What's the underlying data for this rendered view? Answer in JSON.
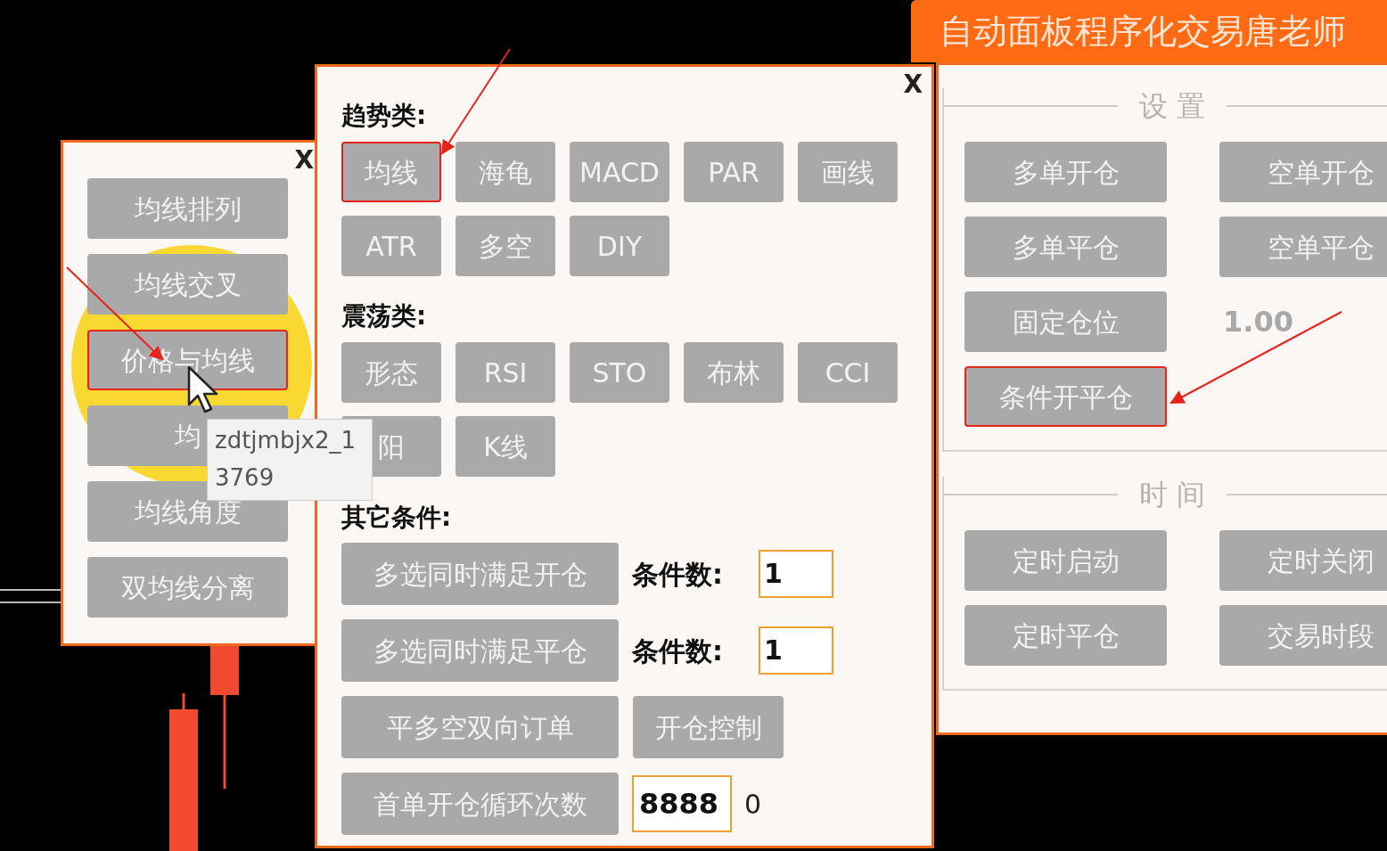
{
  "left_panel": {
    "close": "X",
    "buttons": [
      {
        "label": "均线排列",
        "annotated": false
      },
      {
        "label": "均线交叉",
        "annotated": false
      },
      {
        "label": "价格与均线",
        "annotated": true
      },
      {
        "label": "均",
        "annotated": false
      },
      {
        "label": "均线角度",
        "annotated": false
      },
      {
        "label": "双均线分离",
        "annotated": false
      }
    ]
  },
  "tooltip": {
    "lines": [
      "zdtjmbjx2_1",
      "3769"
    ]
  },
  "middle_panel": {
    "close": "X",
    "sections": [
      {
        "title": "趋势类:",
        "rows": [
          [
            {
              "label": "均线",
              "annotated": true
            },
            {
              "label": "海龟",
              "annotated": false
            },
            {
              "label": "MACD",
              "annotated": false
            },
            {
              "label": "PAR",
              "annotated": false
            },
            {
              "label": "画线",
              "annotated": false
            }
          ],
          [
            {
              "label": "ATR",
              "annotated": false
            },
            {
              "label": "多空",
              "annotated": false
            },
            {
              "label": "DIY",
              "annotated": false
            }
          ]
        ]
      },
      {
        "title": "震荡类:",
        "rows": [
          [
            {
              "label": "形态",
              "annotated": false
            },
            {
              "label": "RSI",
              "annotated": false
            },
            {
              "label": "STO",
              "annotated": false
            },
            {
              "label": "布林",
              "annotated": false
            },
            {
              "label": "CCI",
              "annotated": false
            }
          ],
          [
            {
              "label": "阳",
              "annotated": false
            },
            {
              "label": "K线",
              "annotated": false
            }
          ]
        ]
      }
    ],
    "other": {
      "title": "其它条件:",
      "rows": [
        {
          "kind": "count",
          "button": "多选同时满足开仓",
          "label": "条件数:",
          "value": "1"
        },
        {
          "kind": "count",
          "button": "多选同时满足平仓",
          "label": "条件数:",
          "value": "1"
        },
        {
          "kind": "pair",
          "button": "平多空双向订单",
          "second": "开仓控制"
        },
        {
          "kind": "cycle",
          "button": "首单开仓循环次数",
          "value": "8888",
          "note": "0"
        }
      ]
    }
  },
  "right_panel": {
    "title": "自动面板程序化交易唐老师",
    "groups": [
      {
        "title": "设 置",
        "rows": [
          [
            {
              "kind": "button",
              "label": "多单开仓",
              "annotated": false
            },
            {
              "kind": "button",
              "label": "空单开仓",
              "annotated": false
            }
          ],
          [
            {
              "kind": "button",
              "label": "多单平仓",
              "annotated": false
            },
            {
              "kind": "button",
              "label": "空单平仓",
              "annotated": false
            }
          ],
          [
            {
              "kind": "button",
              "label": "固定仓位",
              "annotated": false
            },
            {
              "kind": "value",
              "text": "1.00"
            }
          ],
          [
            {
              "kind": "button",
              "label": "条件开平仓",
              "annotated": true
            }
          ]
        ]
      },
      {
        "title": "时 间",
        "rows": [
          [
            {
              "kind": "button",
              "label": "定时启动",
              "annotated": false
            },
            {
              "kind": "button",
              "label": "定时关闭",
              "annotated": false
            }
          ],
          [
            {
              "kind": "button",
              "label": "定时平仓",
              "annotated": false
            },
            {
              "kind": "button",
              "label": "交易时段",
              "annotated": false
            }
          ]
        ]
      }
    ]
  }
}
